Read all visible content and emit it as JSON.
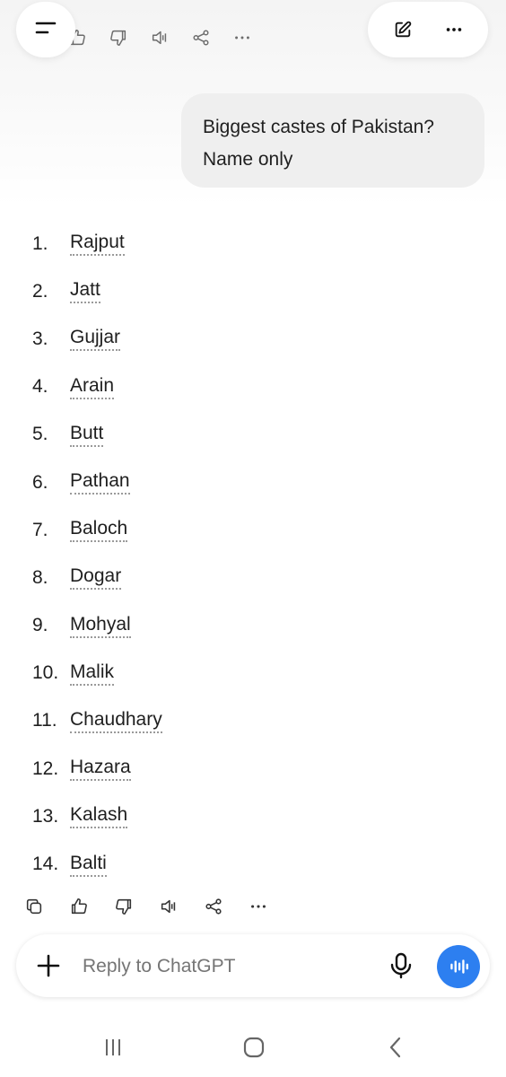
{
  "top_bar": {
    "menu_icon": "menu-icon",
    "message_actions_icons": [
      "thumbs-up-icon",
      "thumbs-down-icon",
      "speaker-icon",
      "share-icon",
      "more-icon"
    ],
    "new_chat_icon": "edit-icon",
    "options_icon": "more-icon"
  },
  "conversation": {
    "user_message": {
      "line1": "Biggest castes of Pakistan?",
      "line2": "Name only"
    },
    "answer": {
      "items": [
        {
          "num": "1.",
          "name": "Rajput"
        },
        {
          "num": "2.",
          "name": "Jatt"
        },
        {
          "num": "3.",
          "name": "Gujjar"
        },
        {
          "num": "4.",
          "name": "Arain"
        },
        {
          "num": "5.",
          "name": "Butt"
        },
        {
          "num": "6.",
          "name": "Pathan"
        },
        {
          "num": "7.",
          "name": "Baloch"
        },
        {
          "num": "8.",
          "name": "Dogar"
        },
        {
          "num": "9.",
          "name": "Mohyal"
        },
        {
          "num": "10.",
          "name": "Malik"
        },
        {
          "num": "11.",
          "name": "Chaudhary"
        },
        {
          "num": "12.",
          "name": "Hazara"
        },
        {
          "num": "13.",
          "name": "Kalash"
        },
        {
          "num": "14.",
          "name": "Balti"
        }
      ]
    },
    "message_actions": [
      "copy-icon",
      "thumbs-up-icon",
      "thumbs-down-icon",
      "speaker-icon",
      "share-icon",
      "more-icon"
    ]
  },
  "composer": {
    "placeholder": "Reply to ChatGPT",
    "add_icon": "plus-icon",
    "mic_icon": "mic-icon",
    "voice_icon": "voice-mode-icon",
    "accent_color": "#2d7ff0"
  },
  "system_nav": {
    "recents_icon": "recents-icon",
    "home_icon": "home-icon",
    "back_icon": "back-icon"
  }
}
